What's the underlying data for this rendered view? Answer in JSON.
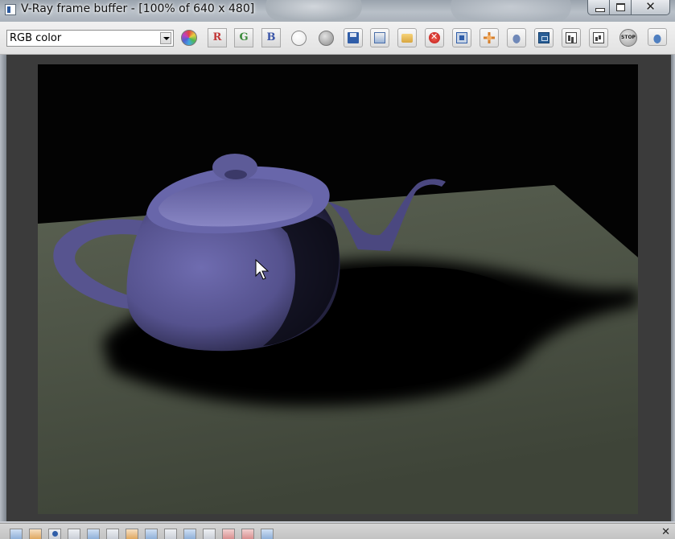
{
  "window": {
    "title": "V-Ray frame buffer - [100% of 640 x 480]",
    "close_glyph": "✕"
  },
  "toolbar": {
    "channel_select": {
      "value": "RGB color"
    },
    "channel_buttons": {
      "r": "R",
      "g": "G",
      "b": "B"
    },
    "stop_label": "STOP",
    "icons": [
      "rgb-channels-icon",
      "red-channel-icon",
      "green-channel-icon",
      "blue-channel-icon",
      "white-circle-icon",
      "mono-circle-icon",
      "save-image-icon",
      "copy-to-max-fb-icon",
      "open-image-icon",
      "clear-image-icon",
      "region-render-icon",
      "track-mouse-icon",
      "render-teapot-icon",
      "stamp-icon",
      "histogram-icon",
      "lut-icon",
      "stop-icon",
      "render-last-icon"
    ]
  },
  "render": {
    "description_colors": {
      "background": "#030303",
      "floor": "#52594a",
      "teapot": "#5d5b98",
      "shadow": "#000000"
    }
  },
  "bottom": {
    "close_glyph": "✕"
  }
}
